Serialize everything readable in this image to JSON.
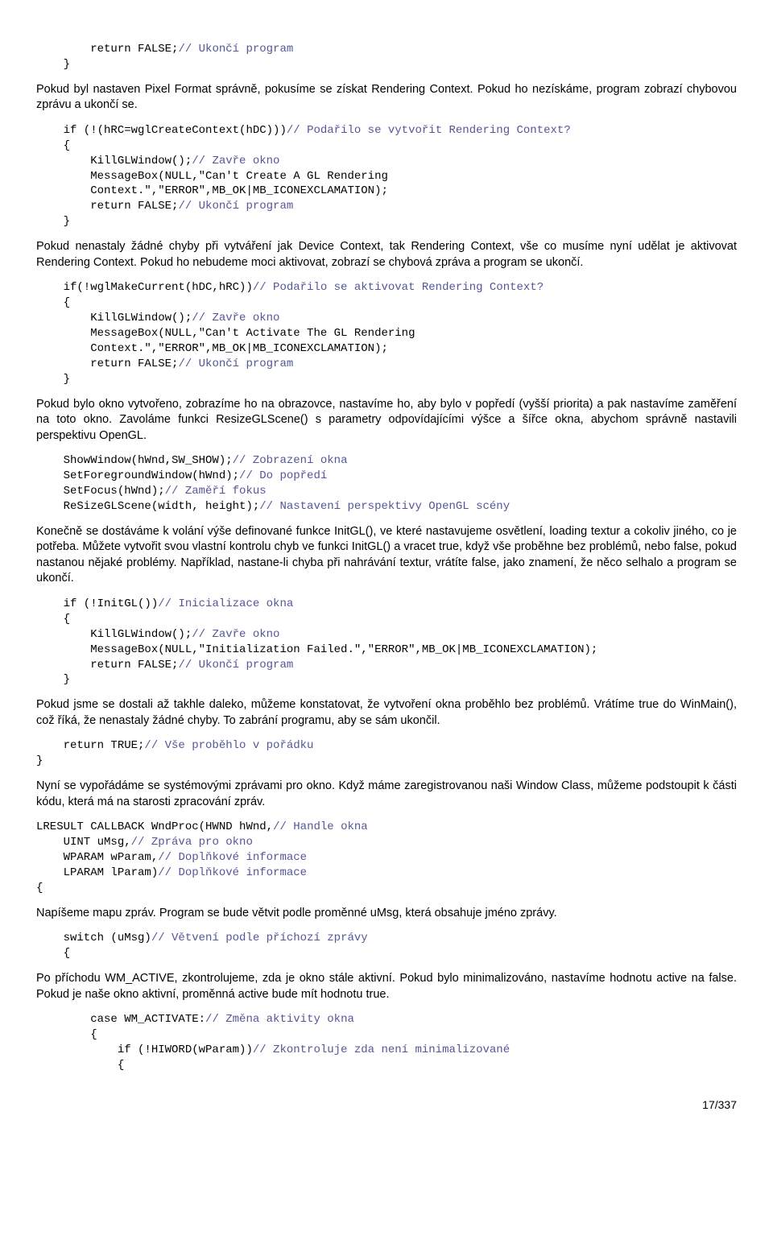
{
  "code1": {
    "line1a": "        return FALSE;",
    "line1b": "// Ukončí program",
    "line2": "    }"
  },
  "para1": "Pokud byl nastaven Pixel Format správně, pokusíme se získat Rendering Context. Pokud ho nezískáme, program zobrazí chybovou zprávu a ukončí se.",
  "code2": {
    "l1a": "    if (!(hRC=wglCreateContext(hDC)))",
    "l1b": "// Podařilo se vytvořit Rendering Context?",
    "l2": "    {",
    "l3a": "        KillGLWindow();",
    "l3b": "// Zavře okno",
    "l4": "        MessageBox(NULL,\"Can't Create A GL Rendering",
    "l5": "        Context.\",\"ERROR\",MB_OK|MB_ICONEXCLAMATION);",
    "l6a": "        return FALSE;",
    "l6b": "// Ukončí program",
    "l7": "    }"
  },
  "para2": "Pokud nenastaly žádné chyby při vytváření jak Device Context, tak Rendering Context, vše co musíme nyní udělat je aktivovat Rendering Context. Pokud ho nebudeme moci aktivovat, zobrazí se chybová zpráva a program se ukončí.",
  "code3": {
    "l1a": "    if(!wglMakeCurrent(hDC,hRC))",
    "l1b": "// Podařilo se aktivovat Rendering Context?",
    "l2": "    {",
    "l3a": "        KillGLWindow();",
    "l3b": "// Zavře okno",
    "l4": "        MessageBox(NULL,\"Can't Activate The GL Rendering",
    "l5": "        Context.\",\"ERROR\",MB_OK|MB_ICONEXCLAMATION);",
    "l6a": "        return FALSE;",
    "l6b": "// Ukončí program",
    "l7": "    }"
  },
  "para3": "Pokud bylo okno vytvořeno, zobrazíme ho na obrazovce, nastavíme ho, aby bylo v popředí (vyšší priorita) a pak nastavíme zaměření na toto okno. Zavoláme funkci ResizeGLScene() s parametry odpovídajícími výšce a šířce okna, abychom správně nastavili perspektivu OpenGL.",
  "code4": {
    "l1a": "    ShowWindow(hWnd,SW_SHOW);",
    "l1b": "// Zobrazení okna",
    "l2a": "    SetForegroundWindow(hWnd);",
    "l2b": "// Do popředí",
    "l3a": "    SetFocus(hWnd);",
    "l3b": "// Zaměří fokus",
    "l4a": "    ReSizeGLScene(width, height);",
    "l4b": "// Nastavení perspektivy OpenGL scény"
  },
  "para4": "Konečně se dostáváme k volání výše definované funkce InitGL(), ve které nastavujeme osvětlení, loading textur a cokoliv jiného, co je potřeba. Můžete vytvořit svou vlastní kontrolu chyb ve funkci InitGL() a vracet true, když vše proběhne bez problémů, nebo false, pokud nastanou nějaké problémy. Například, nastane-li chyba při nahrávání textur, vrátíte false, jako znamení, že něco selhalo a program se ukončí.",
  "code5": {
    "l1a": "    if (!InitGL())",
    "l1b": "// Inicializace okna",
    "l2": "    {",
    "l3a": "        KillGLWindow();",
    "l3b": "// Zavře okno",
    "l4": "        MessageBox(NULL,\"Initialization Failed.\",\"ERROR\",MB_OK|MB_ICONEXCLAMATION);",
    "l5a": "        return FALSE;",
    "l5b": "// Ukončí program",
    "l6": "    }"
  },
  "para5": "Pokud jsme se dostali až takhle daleko, můžeme konstatovat, že vytvoření okna proběhlo bez problémů. Vrátíme true do WinMain(), což říká, že nenastaly žádné chyby. To zabrání programu, aby se sám ukončil.",
  "code6": {
    "l1a": "    return TRUE;",
    "l1b": "// Vše proběhlo v pořádku",
    "l2": "}"
  },
  "para6": "Nyní se vypořádáme se systémovými zprávami pro okno. Když máme zaregistrovanou naši Window Class, můžeme podstoupit k části kódu, která má na starosti zpracování zpráv.",
  "code7": {
    "l1a": "LRESULT CALLBACK WndProc(HWND hWnd,",
    "l1b": "// Handle okna",
    "l2a": "    UINT uMsg,",
    "l2b": "// Zpráva pro okno",
    "l3a": "    WPARAM wParam,",
    "l3b": "// Doplňkové informace",
    "l4a": "    LPARAM lParam)",
    "l4b": "// Doplňkové informace",
    "l5": "{"
  },
  "para7": "Napíšeme mapu zpráv. Program se bude větvit podle proměnné uMsg, která obsahuje jméno zprávy.",
  "code8": {
    "l1a": "    switch (uMsg)",
    "l1b": "// Větvení podle příchozí zprávy",
    "l2": "    {"
  },
  "para8": "Po příchodu WM_ACTIVE, zkontrolujeme, zda je okno stále aktivní. Pokud bylo minimalizováno, nastavíme hodnotu active na false. Pokud je naše okno aktivní, proměnná active bude mít hodnotu true.",
  "code9": {
    "l1a": "        case WM_ACTIVATE:",
    "l1b": "// Změna aktivity okna",
    "l2": "        {",
    "l3a": "            if (!HIWORD(wParam))",
    "l3b": "// Zkontroluje zda není minimalizované",
    "l4": "            {"
  },
  "pagenum": "17/337"
}
